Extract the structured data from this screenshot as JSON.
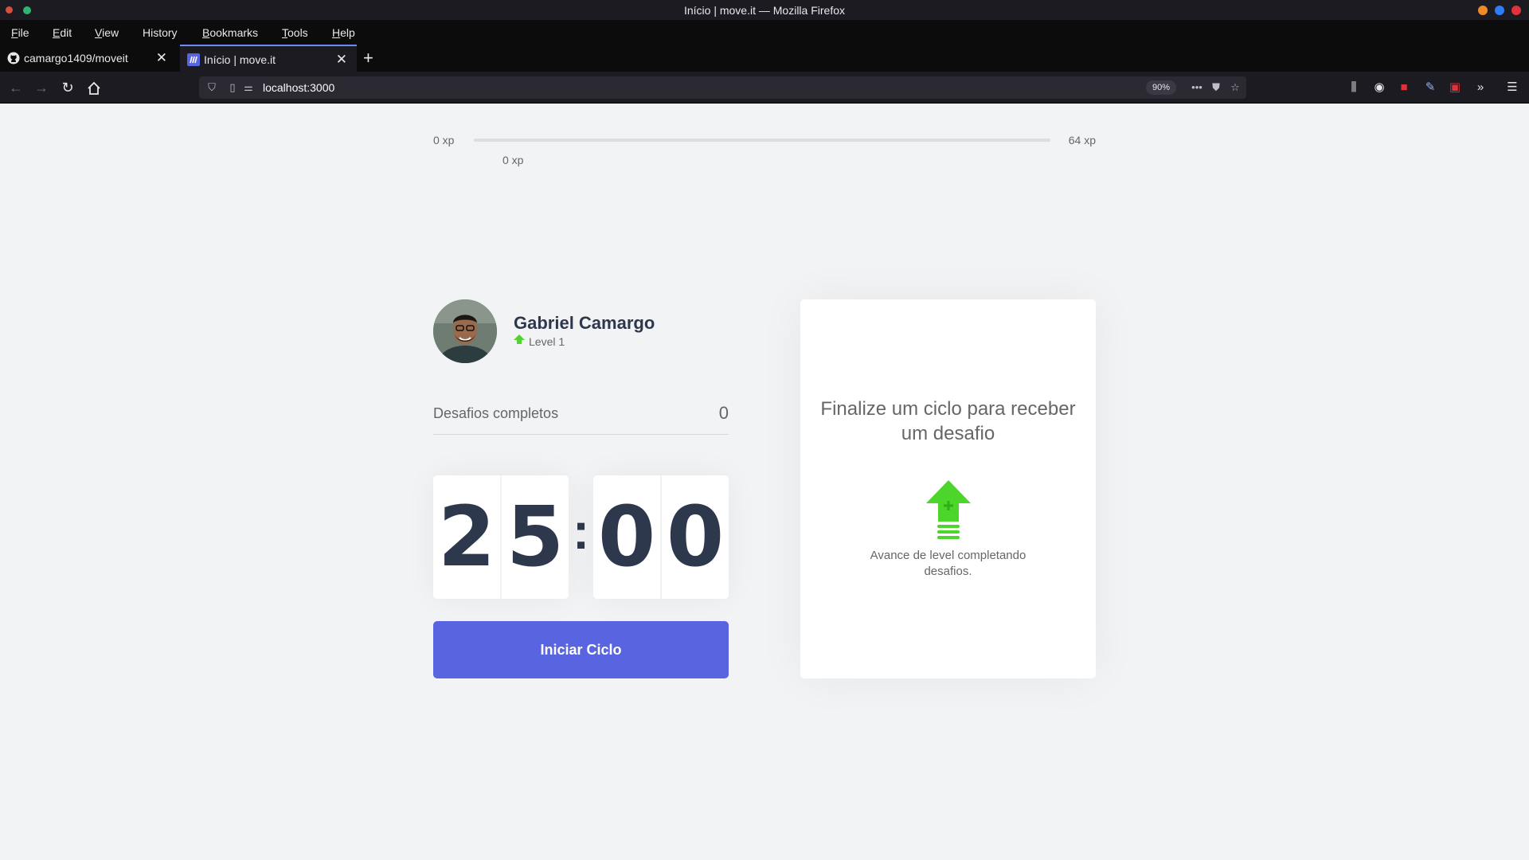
{
  "window": {
    "title": "Início | move.it — Mozilla Firefox"
  },
  "menubar": {
    "items": [
      {
        "label": "File",
        "mnemonic": "F",
        "rest": "ile"
      },
      {
        "label": "Edit",
        "mnemonic": "E",
        "rest": "dit"
      },
      {
        "label": "View",
        "mnemonic": "V",
        "rest": "iew"
      },
      {
        "label": "History",
        "mnemonic": "",
        "rest": "History"
      },
      {
        "label": "Bookmarks",
        "mnemonic": "B",
        "rest": "ookmarks"
      },
      {
        "label": "Tools",
        "mnemonic": "T",
        "rest": "ools"
      },
      {
        "label": "Help",
        "mnemonic": "H",
        "rest": "elp"
      }
    ]
  },
  "tabs": [
    {
      "label": "camargo1409/moveit",
      "icon": "github-icon",
      "active": false
    },
    {
      "label": "Início | move.it",
      "icon": "moveit-icon",
      "active": true
    }
  ],
  "navbar": {
    "url": "localhost:3000",
    "zoom": "90%"
  },
  "xp": {
    "min_label": "0 xp",
    "max_label": "64 xp",
    "current_label": "0 xp",
    "progress_percent": 0
  },
  "profile": {
    "name": "Gabriel Camargo",
    "level_label": "Level 1"
  },
  "challenges": {
    "label": "Desafios completos",
    "value": "0"
  },
  "countdown": {
    "minute_left": "2",
    "minute_right": "5",
    "separator": ":",
    "second_left": "0",
    "second_right": "0"
  },
  "start_button": {
    "label": "Iniciar Ciclo"
  },
  "challenge_box": {
    "title": "Finalize um ciclo para receber um desafio",
    "description": "Avance de level completando desafios."
  },
  "colors": {
    "accent": "#5965e0",
    "level_green": "#4cd62b",
    "text_title": "#2e384d",
    "text_body": "#666666",
    "background": "#f2f3f5"
  }
}
